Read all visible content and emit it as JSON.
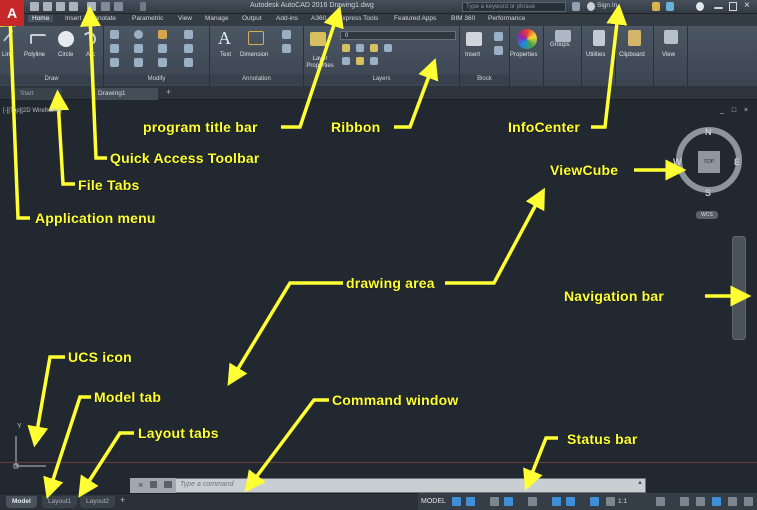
{
  "titlebar": {
    "app_title": "Autodesk AutoCAD 2016    Drawing1.dwg",
    "search_placeholder": "Type a keyword or phrase",
    "sign_in": "Sign In"
  },
  "ribbon_tabs": [
    "Home",
    "Insert",
    "Annotate",
    "Parametric",
    "View",
    "Manage",
    "Output",
    "Add-ins",
    "A360",
    "Express Tools",
    "Featured Apps",
    "BIM 360",
    "Performance"
  ],
  "ribbon": {
    "draw_tools": [
      "Line",
      "Polyline",
      "Circle",
      "Arc"
    ],
    "annotation_tools": [
      "Text",
      "Dimension"
    ],
    "layer_properties": "Layer Properties",
    "layer_value": "0",
    "insert_label": "Insert",
    "properties_label": "Properties",
    "groups_label": "Groups",
    "utilities_label": "Utilities",
    "clipboard_label": "Clipboard",
    "view_label": "View",
    "panels": [
      "Draw",
      "Modify",
      "Annotation",
      "Layers",
      "Block"
    ]
  },
  "file_tabs": [
    "Start",
    "Drawing1"
  ],
  "viewport": {
    "label": "[-][Top][2D Wireframe]",
    "window_controls": "_ □ ×"
  },
  "viewcube": {
    "north": "N",
    "south": "S",
    "east": "E",
    "west": "W",
    "top": "TOP",
    "wcs": "WCS"
  },
  "ucs_axis": "Y",
  "command": {
    "placeholder": "Type a command"
  },
  "layout_tabs": [
    "Model",
    "Layout1",
    "Layout2"
  ],
  "add_layout": "+",
  "status": {
    "model": "MODEL",
    "scale": "1:1"
  },
  "annotations": {
    "program_title_bar": "program title bar",
    "ribbon": "Ribbon",
    "infocenter": "InfoCenter",
    "quick_access_toolbar": "Quick Access Toolbar",
    "viewcube": "ViewCube",
    "file_tabs": "File Tabs",
    "application_menu": "Application menu",
    "drawing_area": "drawing area",
    "navigation_bar": "Navigation bar",
    "ucs_icon": "UCS icon",
    "model_tab": "Model tab",
    "command_window": "Command window",
    "layout_tabs": "Layout tabs",
    "status_bar": "Status bar"
  },
  "colors": {
    "annotation": "#ffff33",
    "canvas": "#212830",
    "app_button": "#c62828"
  }
}
